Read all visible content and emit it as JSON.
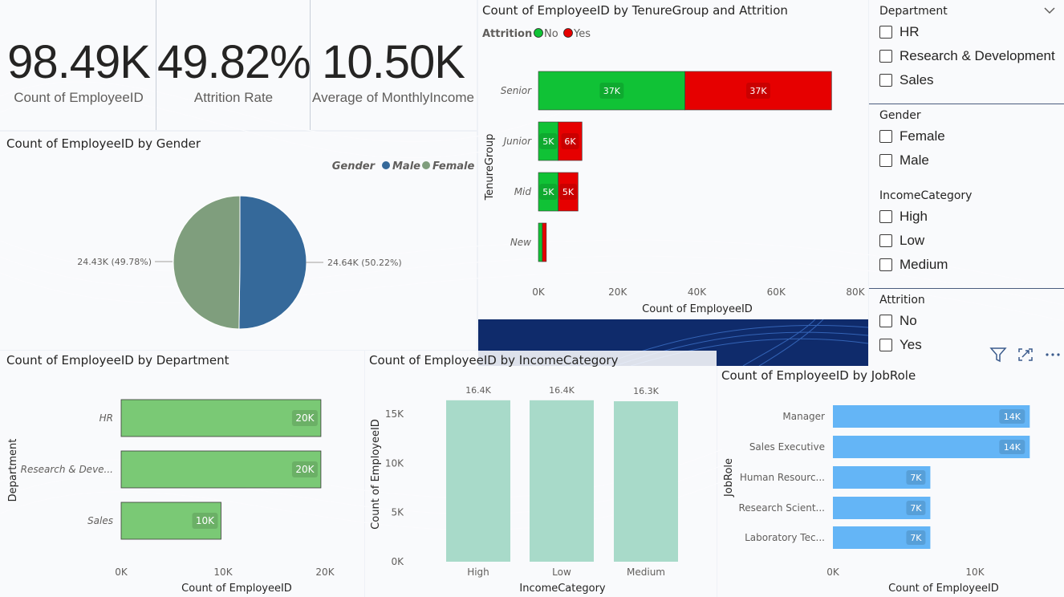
{
  "kpis": [
    {
      "value": "98.49K",
      "label": "Count of EmployeeID"
    },
    {
      "value": "49.82%",
      "label": "Attrition Rate"
    },
    {
      "value": "10.50K",
      "label": "Average of MonthlyIncome"
    }
  ],
  "gender_chart": {
    "title": "Count of EmployeeID by Gender",
    "legend_title": "Gender",
    "labels": {
      "male": "24.64K (50.22%)",
      "female": "24.43K (49.78%)"
    },
    "chart_data": {
      "type": "pie",
      "legend": {
        "title": "Gender",
        "placement": "top-right"
      },
      "slices": [
        {
          "name": "Male",
          "value": 24.64,
          "percent": 50.22,
          "label": "24.64K (50.22%)",
          "color": "#35699a"
        },
        {
          "name": "Female",
          "value": 24.43,
          "percent": 49.78,
          "label": "24.43K (49.78%)",
          "color": "#7f9e7d"
        }
      ]
    }
  },
  "tenure_chart": {
    "title": "Count of EmployeeID by TenureGroup and Attrition",
    "legend_title": "Attrition",
    "chart_data": {
      "type": "bar",
      "orientation": "horizontal",
      "stacked": true,
      "title": "Count of EmployeeID by TenureGroup and Attrition",
      "xlabel": "Count of EmployeeID",
      "ylabel": "TenureGroup",
      "categories": [
        "Senior",
        "Junior",
        "Mid",
        "New"
      ],
      "series": [
        {
          "name": "No",
          "color": "#10c236",
          "values": [
            37000,
            5000,
            5000,
            1000
          ],
          "labels": [
            "37K",
            "5K",
            "5K",
            ""
          ]
        },
        {
          "name": "Yes",
          "color": "#e60000",
          "values": [
            37000,
            6000,
            5000,
            1000
          ],
          "labels": [
            "37K",
            "6K",
            "5K",
            ""
          ]
        }
      ],
      "xlim": [
        0,
        80000
      ],
      "xticks": [
        "0K",
        "20K",
        "40K",
        "60K",
        "80K"
      ],
      "legend": {
        "title": "Attrition",
        "placement": "top-left"
      }
    }
  },
  "department_chart": {
    "title": "Count of EmployeeID by Department",
    "chart_data": {
      "type": "bar",
      "orientation": "horizontal",
      "title": "Count of EmployeeID by Department",
      "xlabel": "Count of EmployeeID",
      "ylabel": "Department",
      "categories": [
        "HR",
        "Research & Deve...",
        "Sales"
      ],
      "values": [
        20000,
        20000,
        10000
      ],
      "labels": [
        "20K",
        "20K",
        "10K"
      ],
      "xlim": [
        0,
        20000
      ],
      "xticks": [
        "0K",
        "10K",
        "20K"
      ],
      "color": "#7ac975"
    }
  },
  "income_chart": {
    "title": "Count of EmployeeID by IncomeCategory",
    "chart_data": {
      "type": "bar",
      "orientation": "vertical",
      "title": "Count of EmployeeID by IncomeCategory",
      "xlabel": "IncomeCategory",
      "ylabel": "Count of EmployeeID",
      "categories": [
        "High",
        "Low",
        "Medium"
      ],
      "values": [
        16400,
        16400,
        16300
      ],
      "labels": [
        "16.4K",
        "16.4K",
        "16.3K"
      ],
      "ylim": [
        0,
        15000
      ],
      "yticks": [
        "0K",
        "5K",
        "10K",
        "15K"
      ],
      "color": "#a8dac9"
    }
  },
  "jobrole_chart": {
    "title": "Count of EmployeeID by JobRole",
    "chart_data": {
      "type": "bar",
      "orientation": "horizontal",
      "title": "Count of EmployeeID by JobRole",
      "xlabel": "Count of EmployeeID",
      "ylabel": "JobRole",
      "categories": [
        "Manager",
        "Sales Executive",
        "Human Resourc...",
        "Research Scient...",
        "Laboratory Tec..."
      ],
      "values": [
        14000,
        14000,
        7000,
        7000,
        7000
      ],
      "labels": [
        "14K",
        "14K",
        "7K",
        "7K",
        "7K"
      ],
      "xlim": [
        0,
        10000
      ],
      "xticks": [
        "0K",
        "10K"
      ],
      "color": "#64b5f6"
    }
  },
  "slicers": [
    {
      "title": "Department",
      "items": [
        "HR",
        "Research & Development",
        "Sales"
      ]
    },
    {
      "title": "Gender",
      "items": [
        "Female",
        "Male"
      ]
    },
    {
      "title": "IncomeCategory",
      "items": [
        "High",
        "Low",
        "Medium"
      ]
    },
    {
      "title": "Attrition",
      "items": [
        "No",
        "Yes"
      ]
    }
  ],
  "colors": {
    "no": "#10c236",
    "yes": "#e60000",
    "male": "#35699a",
    "female": "#7f9e7d",
    "department": "#7ac975",
    "income": "#a8dac9",
    "jobrole": "#64b5f6",
    "banner": "#0f2b6b"
  },
  "icons": [
    "chevron-down-icon",
    "filter-icon",
    "focus-mode-icon",
    "more-options-icon"
  ]
}
